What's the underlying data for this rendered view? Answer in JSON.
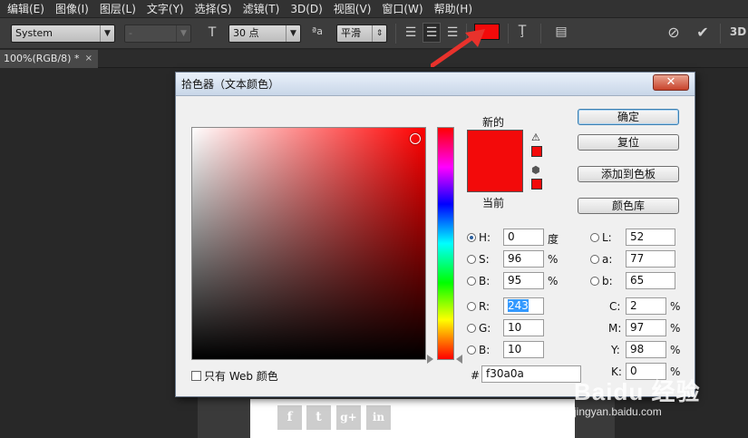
{
  "menu": [
    "编辑(E)",
    "图像(I)",
    "图层(L)",
    "文字(Y)",
    "选择(S)",
    "滤镜(T)",
    "3D(D)",
    "视图(V)",
    "窗口(W)",
    "帮助(H)"
  ],
  "options": {
    "font_family": "System",
    "font_style": "-",
    "font_size": "30 点",
    "antialias": "平滑",
    "text_color": "#f30a0a"
  },
  "document_tab": {
    "title": "100%(RGB/8) *",
    "close": "×"
  },
  "dialog": {
    "title": "拾色器（文本颜色）",
    "close": "✕",
    "label_new": "新的",
    "label_current": "当前",
    "web_only_label": "只有 Web 颜色",
    "buttons": {
      "ok": "确定",
      "reset": "复位",
      "add_to_swatches": "添加到色板",
      "color_libraries": "颜色库"
    },
    "hsb": {
      "h_label": "H:",
      "h": "0",
      "h_unit": "度",
      "s_label": "S:",
      "s": "96",
      "s_unit": "%",
      "b_label": "B:",
      "b": "95",
      "b_unit": "%"
    },
    "rgb": {
      "r_label": "R:",
      "r": "243",
      "g_label": "G:",
      "g": "10",
      "b_label": "B:",
      "b": "10"
    },
    "lab": {
      "l_label": "L:",
      "l": "52",
      "a_label": "a:",
      "a": "77",
      "b_label": "b:",
      "b": "65"
    },
    "cmyk": {
      "c_label": "C:",
      "c": "2",
      "m_label": "M:",
      "m": "97",
      "y_label": "Y:",
      "y": "98",
      "k_label": "K:",
      "k": "0",
      "unit": "%"
    },
    "hex_label": "#",
    "hex": "f30a0a",
    "new_color": "#f30a0a",
    "current_color": "#f30a0a"
  },
  "social": [
    "f",
    "t",
    "g+",
    "in"
  ],
  "watermark": {
    "main": "Baidu 经验",
    "sub": "jingyan.baidu.com"
  }
}
